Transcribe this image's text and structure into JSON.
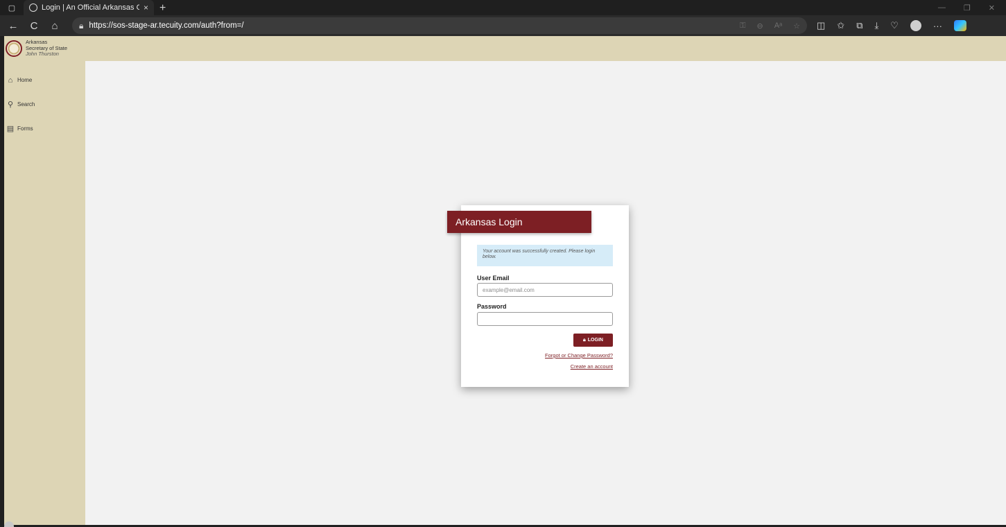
{
  "browser": {
    "tab": {
      "title": "Login | An Official Arkansas Gove",
      "close_glyph": "×"
    },
    "new_tab_glyph": "+",
    "window_controls": [
      "—",
      "❐",
      "✕"
    ],
    "address": {
      "url": "https://sos-stage-ar.tecuity.com/auth?from=/"
    },
    "nav": {
      "back": "←",
      "refresh": "C",
      "home": "⌂"
    },
    "address_icons": [
      "key-icon",
      "zoom-icon",
      "read-aloud-icon",
      "favorite-icon"
    ],
    "toolbar_icons": [
      "split-screen-icon",
      "favorites-icon",
      "collections-icon",
      "downloads-icon",
      "performance-icon",
      "profile-icon",
      "more-icon",
      "copilot-icon"
    ]
  },
  "app": {
    "brand": {
      "line1": "Arkansas",
      "line2": "Secretary of State",
      "line3": "John Thurston"
    },
    "sidebar": {
      "items": [
        {
          "label": "Home",
          "icon": "home-icon"
        },
        {
          "label": "Search",
          "icon": "search-icon"
        },
        {
          "label": "Forms",
          "icon": "forms-icon"
        }
      ]
    }
  },
  "login": {
    "title": "Arkansas Login",
    "alert": "Your account was successfully created. Please login below.",
    "email_label": "User Email",
    "email_placeholder": "example@email.com",
    "email_value": "",
    "password_label": "Password",
    "password_value": "",
    "login_button": "LOGIN",
    "forgot_link": "Forgot or Change Password?",
    "create_link": "Create an account"
  },
  "colors": {
    "brand_maroon": "#7d1f24",
    "sidebar_tan": "#ddd5b5",
    "alert_blue": "#d6ecf8",
    "page_bg": "#f2f2f2"
  }
}
